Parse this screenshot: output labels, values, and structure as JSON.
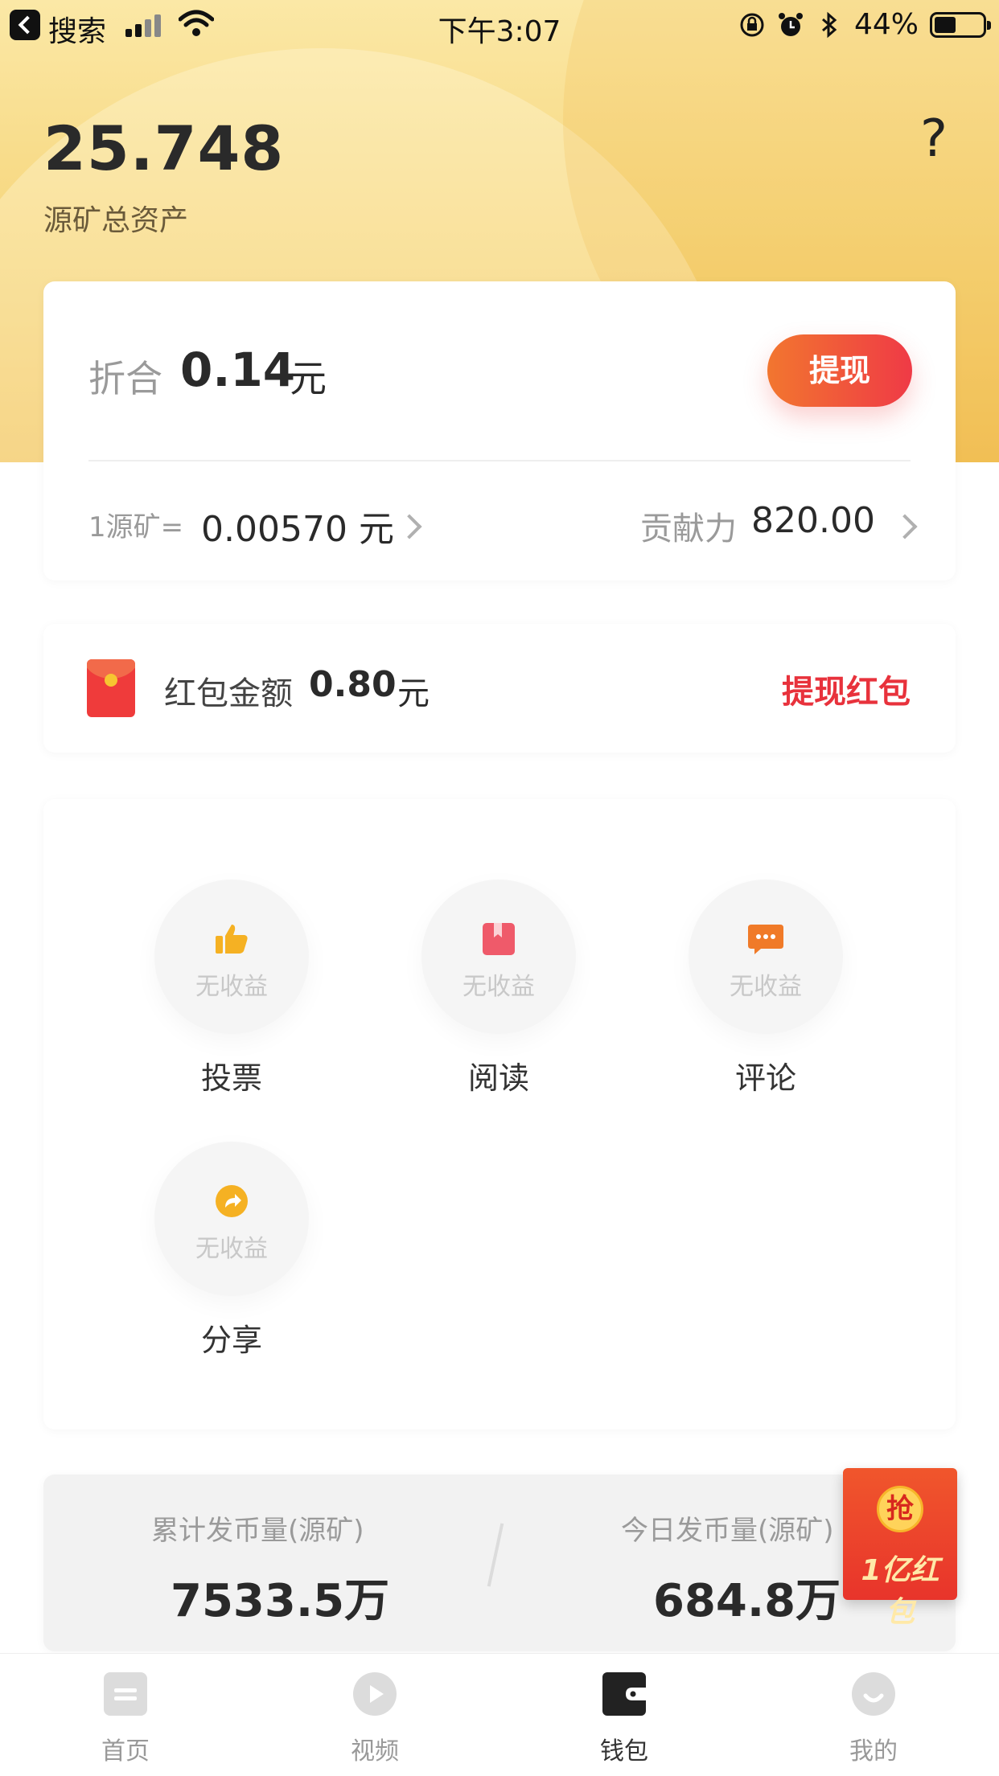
{
  "status_bar": {
    "carrier": "搜索",
    "time": "下午3:07",
    "battery": "44%"
  },
  "header": {
    "total_value": "25.748",
    "total_label": "源矿总资产",
    "help_icon": "?"
  },
  "summary": {
    "zhehe_label": "折合",
    "zhehe_value": "0.14",
    "zhehe_unit": "元",
    "withdraw_label": "提现",
    "rate_label": "1源矿=",
    "rate_value": "0.00570 元",
    "contribution_label": "贡献力",
    "contribution_value": "820.00"
  },
  "red_packet": {
    "label": "红包金额",
    "value": "0.80",
    "unit": "元",
    "withdraw_label": "提现红包"
  },
  "tasks": [
    {
      "name": "投票",
      "status": "无收益",
      "icon": "thumbs-up-icon"
    },
    {
      "name": "阅读",
      "status": "无收益",
      "icon": "book-icon"
    },
    {
      "name": "评论",
      "status": "无收益",
      "icon": "comment-icon"
    },
    {
      "name": "分享",
      "status": "无收益",
      "icon": "share-icon"
    }
  ],
  "stats": {
    "cumulative_label": "累计发币量(源矿)",
    "cumulative_value": "7533.5万",
    "today_label": "今日发币量(源矿)",
    "today_value": "684.8万"
  },
  "promo": {
    "coin_text": "抢",
    "text": "1亿红包"
  },
  "tabbar": [
    {
      "label": "首页",
      "icon": "home-icon",
      "active": false
    },
    {
      "label": "视频",
      "icon": "play-icon",
      "active": false
    },
    {
      "label": "钱包",
      "icon": "wallet-icon",
      "active": true
    },
    {
      "label": "我的",
      "icon": "profile-icon",
      "active": false
    }
  ],
  "colors": {
    "accent_red": "#e8323c",
    "button_gradient_start": "#f2762f",
    "button_gradient_end": "#ef3a46",
    "header_gold": "#f6d57a"
  }
}
